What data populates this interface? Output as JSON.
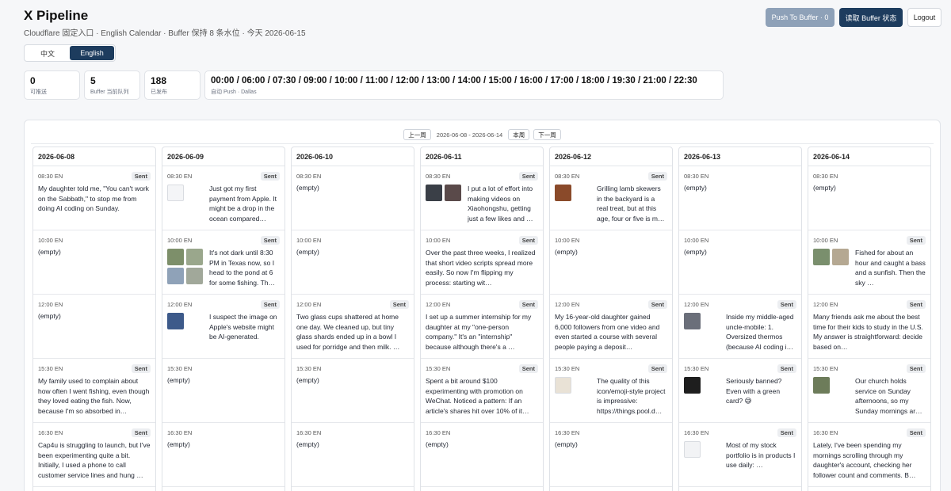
{
  "app": {
    "title": "X Pipeline",
    "subtitle": "Cloudflare 固定入口 · English Calendar · Buffer 保持 8 条水位 · 今天 2026-06-15"
  },
  "actions": {
    "push_label": "Push To Buffer · 0",
    "read_label": "读取 Buffer 状态",
    "logout_label": "Logout"
  },
  "language": {
    "zh": "中文",
    "en": "English",
    "active": "en"
  },
  "stats": [
    {
      "value": "0",
      "label": "可推送"
    },
    {
      "value": "5",
      "label": "Buffer 当前队列"
    },
    {
      "value": "188",
      "label": "已发布"
    }
  ],
  "schedule": {
    "times": "00:00 / 06:00 / 07:30 / 09:00 / 10:00 / 11:00 / 12:00 / 13:00 / 14:00 / 15:00 / 16:00 / 17:00 / 18:00 / 19:30 / 21:00 / 22:30",
    "label": "自动 Push · Dallas"
  },
  "week_nav": {
    "prev": "上一周",
    "range": "2026-06-08 - 2026-06-14",
    "current": "本周",
    "next": "下一周"
  },
  "status_sent": "Sent",
  "empty_text": "(empty)",
  "days": [
    {
      "date": "2026-06-08",
      "slots": [
        {
          "time": "08:30 EN",
          "sent": true,
          "text": "My daughter told me, \"You can't work on the Sabbath,\" to stop me from doing AI coding on Sunday.",
          "thumbs": []
        },
        {
          "time": "10:00 EN",
          "sent": false,
          "text": "",
          "thumbs": []
        },
        {
          "time": "12:00 EN",
          "sent": false,
          "text": "",
          "thumbs": []
        },
        {
          "time": "15:30 EN",
          "sent": true,
          "text": "My family used to complain about how often I went fishing, even though they loved eating the fish. Now, because I'm so absorbed in…",
          "thumbs": []
        },
        {
          "time": "16:30 EN",
          "sent": true,
          "text": "Cap4u is struggling to launch, but I've been experimenting quite a bit. Initially, I used a phone to call customer service lines and hung …",
          "thumbs": []
        }
      ]
    },
    {
      "date": "2026-06-09",
      "slots": [
        {
          "time": "08:30 EN",
          "sent": true,
          "text": "Just got my first payment from Apple. It might be a drop in the ocean compared…",
          "thumbs": [
            "#f4f5f7"
          ]
        },
        {
          "time": "10:00 EN",
          "sent": true,
          "text": "It's not dark until 8:30 PM in Texas now, so I head to the pond at 6 for some fishing. Th…",
          "thumbs": [
            "#7d8f6a",
            "#9aa78c",
            "#8fa2b8",
            "#a1a89a"
          ]
        },
        {
          "time": "12:00 EN",
          "sent": true,
          "text": "I suspect the image on Apple's website might be AI-generated.",
          "thumbs": [
            "#3d5a8a"
          ]
        },
        {
          "time": "15:30 EN",
          "sent": false,
          "text": "",
          "thumbs": []
        },
        {
          "time": "16:30 EN",
          "sent": false,
          "text": "",
          "thumbs": []
        }
      ]
    },
    {
      "date": "2026-06-10",
      "slots": [
        {
          "time": "08:30 EN",
          "sent": false,
          "text": "",
          "thumbs": []
        },
        {
          "time": "10:00 EN",
          "sent": false,
          "text": "",
          "thumbs": []
        },
        {
          "time": "12:00 EN",
          "sent": true,
          "text": "Two glass cups shattered at home one day. We cleaned up, but tiny glass shards ended up in a bowl I used for porridge and then milk. …",
          "thumbs": []
        },
        {
          "time": "15:30 EN",
          "sent": false,
          "text": "",
          "thumbs": []
        },
        {
          "time": "16:30 EN",
          "sent": false,
          "text": "",
          "thumbs": []
        }
      ]
    },
    {
      "date": "2026-06-11",
      "slots": [
        {
          "time": "08:30 EN",
          "sent": true,
          "text": "I put a lot of effort into making videos on Xiaohongshu, getting just a few likes and …",
          "thumbs": [
            "#3a3f47",
            "#5a4a4a"
          ]
        },
        {
          "time": "10:00 EN",
          "sent": true,
          "text": "Over the past three weeks, I realized that short video scripts spread more easily. So now I'm flipping my process: starting wit…",
          "thumbs": []
        },
        {
          "time": "12:00 EN",
          "sent": true,
          "text": "I set up a summer internship for my daughter at my \"one-person company.\" It's an \"internship\" because although there's a …",
          "thumbs": []
        },
        {
          "time": "15:30 EN",
          "sent": true,
          "text": "Spent a bit around $100 experimenting with promotion on WeChat. Noticed a pattern: If an article's shares hit over 10% of it…",
          "thumbs": []
        },
        {
          "time": "16:30 EN",
          "sent": false,
          "text": "",
          "thumbs": []
        }
      ]
    },
    {
      "date": "2026-06-12",
      "slots": [
        {
          "time": "08:30 EN",
          "sent": true,
          "text": "Grilling lamb skewers in the backyard is a real treat, but at this age, four or five is m…",
          "thumbs": [
            "#8a4a2a"
          ]
        },
        {
          "time": "10:00 EN",
          "sent": false,
          "text": "",
          "thumbs": []
        },
        {
          "time": "12:00 EN",
          "sent": true,
          "text": "My 16-year-old daughter gained 6,000 followers from one video and even started a course with several people paying a deposit…",
          "thumbs": []
        },
        {
          "time": "15:30 EN",
          "sent": true,
          "text": "The quality of this icon/emoji-style project is impressive: https://things.pool.d…",
          "thumbs": [
            "#e9e2d6"
          ]
        },
        {
          "time": "16:30 EN",
          "sent": false,
          "text": "",
          "thumbs": []
        }
      ]
    },
    {
      "date": "2026-06-13",
      "slots": [
        {
          "time": "08:30 EN",
          "sent": false,
          "text": "",
          "thumbs": []
        },
        {
          "time": "10:00 EN",
          "sent": false,
          "text": "",
          "thumbs": []
        },
        {
          "time": "12:00 EN",
          "sent": true,
          "text": "Inside my middle-aged uncle-mobile: 1. Oversized thermos (because AI coding i…",
          "thumbs": [
            "#6b6f7a"
          ]
        },
        {
          "time": "15:30 EN",
          "sent": true,
          "text": "Seriously banned? Even with a green card? 😅",
          "thumbs": [
            "#1e1e1e"
          ]
        },
        {
          "time": "16:30 EN",
          "sent": true,
          "text": "Most of my stock portfolio is in products I use daily: …",
          "thumbs": [
            "#f2f3f5"
          ]
        }
      ]
    },
    {
      "date": "2026-06-14",
      "slots": [
        {
          "time": "08:30 EN",
          "sent": false,
          "text": "",
          "thumbs": []
        },
        {
          "time": "10:00 EN",
          "sent": true,
          "text": "Fished for about an hour and caught a bass and a sunfish. Then the sky …",
          "thumbs": [
            "#7a8f6d",
            "#b5a892"
          ]
        },
        {
          "time": "12:00 EN",
          "sent": true,
          "text": "Many friends ask me about the best time for their kids to study in the U.S. My answer is straightforward: decide based on…",
          "thumbs": []
        },
        {
          "time": "15:30 EN",
          "sent": true,
          "text": "Our church holds service on Sunday afternoons, so my Sunday mornings ar…",
          "thumbs": [
            "#6d7c5a"
          ]
        },
        {
          "time": "16:30 EN",
          "sent": true,
          "text": "Lately, I've been spending my mornings scrolling through my daughter's account, checking her follower count and comments. B…",
          "thumbs": []
        }
      ]
    }
  ]
}
